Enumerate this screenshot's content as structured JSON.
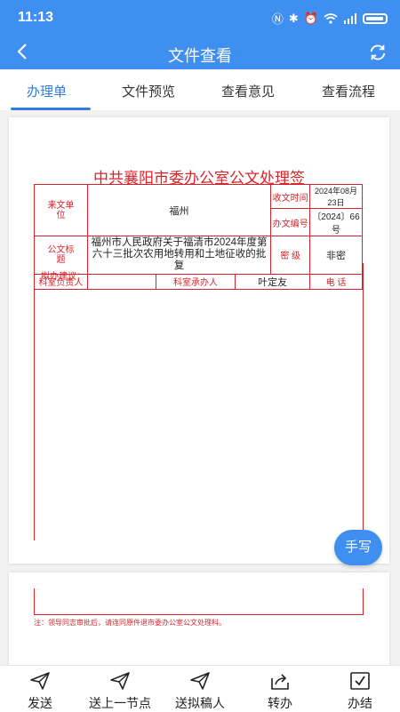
{
  "status_bar": {
    "time": "11:13",
    "icons": [
      "nfc-icon",
      "bluetooth-icon",
      "alarm-icon",
      "wifi-icon",
      "signal-icon",
      "battery-icon"
    ]
  },
  "header": {
    "title": "文件查看",
    "back_icon": "back-arrow-icon",
    "refresh_icon": "refresh-icon"
  },
  "tabs": [
    {
      "label": "办理单",
      "active": true
    },
    {
      "label": "文件预览",
      "active": false
    },
    {
      "label": "查看意见",
      "active": false
    },
    {
      "label": "查看流程",
      "active": false
    }
  ],
  "document": {
    "title": "中共襄阳市委办公室公文处理签",
    "from_unit_label": "来文单位",
    "from_unit": "福州",
    "received_time_label": "收文时间",
    "received_time": "2024年08月23日",
    "doc_number_label": "办文编号",
    "doc_number": "〔2024〕66号",
    "doc_title_label": "公文标题",
    "doc_title": "福州市人民政府关于福清市2024年度第六十三批次农用地转用和土地征收的批复",
    "secret_label": "密 级",
    "secret_value": "非密",
    "dept_head_label": "科室负责人",
    "dept_handler_label": "科室承办人",
    "dept_handler": "叶定友",
    "phone_label": "电 话",
    "suggestion_label": "拟办建议：",
    "note": "注：领导同志审批后，请连同原件退市委办公室公文处理科。"
  },
  "handwrite_button": "手写",
  "bottom_actions": [
    {
      "label": "发送",
      "icon": "send-icon"
    },
    {
      "label": "送上一节点",
      "icon": "send-back-icon"
    },
    {
      "label": "送拟稿人",
      "icon": "send-drafter-icon"
    },
    {
      "label": "转办",
      "icon": "forward-icon"
    },
    {
      "label": "办结",
      "icon": "complete-check-icon"
    }
  ],
  "colors": {
    "primary": "#3f8ff0",
    "document_red": "#d8232a",
    "active_tab": "#2f7de1"
  }
}
